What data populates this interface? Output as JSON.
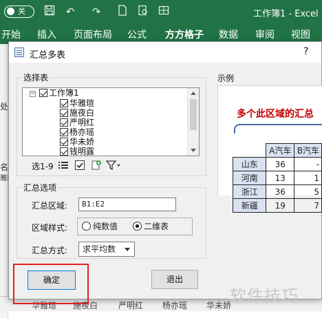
{
  "titlebar": {
    "autosave_state": "关",
    "workbook_title": "工作簿1 - Excel"
  },
  "ribbon": {
    "tabs": [
      "开始",
      "插入",
      "页面布局",
      "公式",
      "方方格子",
      "数据",
      "审阅",
      "视图"
    ],
    "active_bold_tab": "方方格子"
  },
  "sheet": {
    "left_edge_glyphs": [
      "处",
      "名",
      "雅理"
    ],
    "sheet_tabs": [
      "华雅瑄",
      "施夜白",
      "严明红",
      "杨亦瑶",
      "华未娇"
    ]
  },
  "dialog": {
    "title": "汇总多表",
    "help": "?",
    "select_tables": {
      "label": "选择表",
      "root": "工作簿1",
      "items": [
        "华雅瑄",
        "施夜白",
        "严明红",
        "杨亦瑶",
        "华未娇",
        "钱明露"
      ],
      "selection_summary": "选1-9"
    },
    "options": {
      "label": "汇总选项",
      "range_label": "汇总区域:",
      "range_value": "B1:E2",
      "style_label": "区域样式:",
      "style_options": [
        "纯数值",
        "二维表"
      ],
      "style_selected": "二维表",
      "method_label": "汇总方式:",
      "method_value": "求平均数"
    },
    "example": {
      "label": "示例",
      "caption": "多个此区域的汇总",
      "headers": [
        "A汽车",
        "B汽车"
      ],
      "rows": [
        {
          "name": "山东",
          "a": "36",
          "b": "-"
        },
        {
          "name": "河南",
          "a": "13",
          "b": "1"
        },
        {
          "name": "浙江",
          "a": "36",
          "b": "5"
        },
        {
          "name": "新疆",
          "a": "19",
          "b": "7"
        }
      ]
    },
    "buttons": {
      "ok": "确定",
      "cancel": "退出"
    }
  },
  "watermark": "软件技巧",
  "colors": {
    "excel_green": "#217346",
    "highlight_red": "#e02020",
    "caption_red": "#c00000",
    "table_header_blue": "#d9e1f2"
  }
}
